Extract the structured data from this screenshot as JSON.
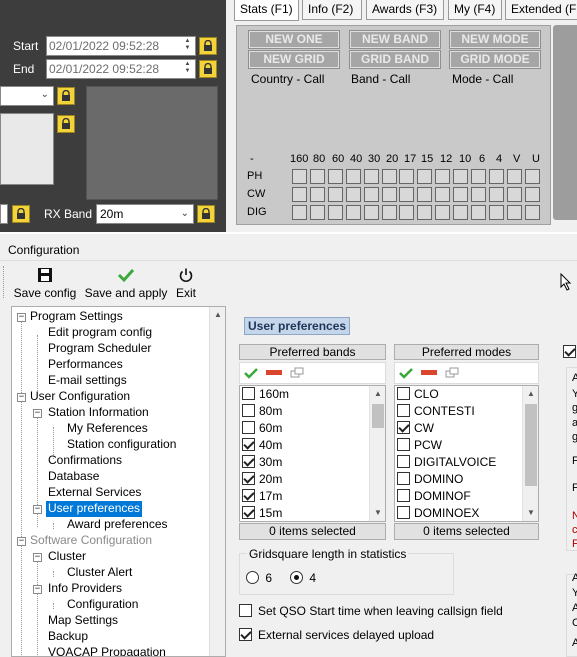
{
  "top": {
    "start_label": "Start",
    "end_label": "End",
    "start_value": "02/01/2022 09:52:28",
    "end_value": "02/01/2022 09:52:28",
    "rx_band_label": "RX Band",
    "rx_band_value": "20m"
  },
  "stats_tabs": [
    "Stats (F1)",
    "Info (F2)",
    "Awards (F3)",
    "My (F4)",
    "Extended (F"
  ],
  "stats": {
    "badges": [
      "NEW ONE",
      "NEW BAND",
      "NEW MODE",
      "NEW GRID",
      "GRID BAND",
      "GRID MODE"
    ],
    "captions": [
      "Country - Call",
      "Band - Call",
      "Mode - Call"
    ],
    "band_headers": [
      "-",
      "160",
      "80",
      "60",
      "40",
      "30",
      "20",
      "17",
      "15",
      "12",
      "10",
      "6",
      "4",
      "V",
      "U"
    ],
    "modes": [
      "PH",
      "CW",
      "DIG"
    ]
  },
  "window": {
    "title": "Configuration",
    "toolbar": {
      "save_config": "Save config",
      "save_apply": "Save and apply",
      "exit": "Exit"
    }
  },
  "tree": {
    "program_settings": "Program Settings",
    "edit_program_config": "Edit program config",
    "program_scheduler": "Program Scheduler",
    "performances": "Performances",
    "email_settings": "E-mail settings",
    "user_configuration": "User Configuration",
    "station_information": "Station Information",
    "my_references": "My References",
    "station_configuration": "Station configuration",
    "confirmations": "Confirmations",
    "database": "Database",
    "external_services": "External Services",
    "user_preferences": "User preferences",
    "award_preferences": "Award preferences",
    "software_configuration": "Software Configuration",
    "cluster": "Cluster",
    "cluster_alert": "Cluster Alert",
    "info_providers": "Info Providers",
    "configuration": "Configuration",
    "map_settings": "Map Settings",
    "backup": "Backup",
    "voacap": "VOACAP Propagation"
  },
  "prefs": {
    "title": "User preferences",
    "bands_header": "Preferred bands",
    "modes_header": "Preferred modes",
    "bands": [
      {
        "label": "160m",
        "checked": false
      },
      {
        "label": "80m",
        "checked": false
      },
      {
        "label": "60m",
        "checked": false
      },
      {
        "label": "40m",
        "checked": true
      },
      {
        "label": "30m",
        "checked": true
      },
      {
        "label": "20m",
        "checked": true
      },
      {
        "label": "17m",
        "checked": true
      },
      {
        "label": "15m",
        "checked": true
      }
    ],
    "modes": [
      {
        "label": "CLO",
        "checked": false
      },
      {
        "label": "CONTESTI",
        "checked": false
      },
      {
        "label": "CW",
        "checked": true
      },
      {
        "label": "PCW",
        "checked": false
      },
      {
        "label": "DIGITALVOICE",
        "checked": false
      },
      {
        "label": "DOMINO",
        "checked": false
      },
      {
        "label": "DOMINOF",
        "checked": false
      },
      {
        "label": "DOMINOEX",
        "checked": false
      }
    ],
    "bands_selected": "0 items selected",
    "modes_selected": "0 items selected",
    "gridsquare_label": "Gridsquare length in statistics",
    "grid_opt_6": "6",
    "grid_opt_4": "4",
    "grid_selected": "4",
    "set_qso_start": "Set QSO Start time when leaving callsign field",
    "set_qso_start_checked": false,
    "ext_delayed": "External services delayed upload",
    "ext_delayed_checked": true
  },
  "right_clip": {
    "letters": [
      "A",
      "Y",
      "g",
      "a",
      "g",
      "F",
      "F",
      "N",
      "c",
      "F",
      "A",
      "Y",
      "A",
      "C",
      "A"
    ]
  },
  "colors": {
    "selection": "#0078d7",
    "lock": "#f3d33a",
    "save_apply_check": "#3aa83a",
    "remove": "#d9462d"
  }
}
